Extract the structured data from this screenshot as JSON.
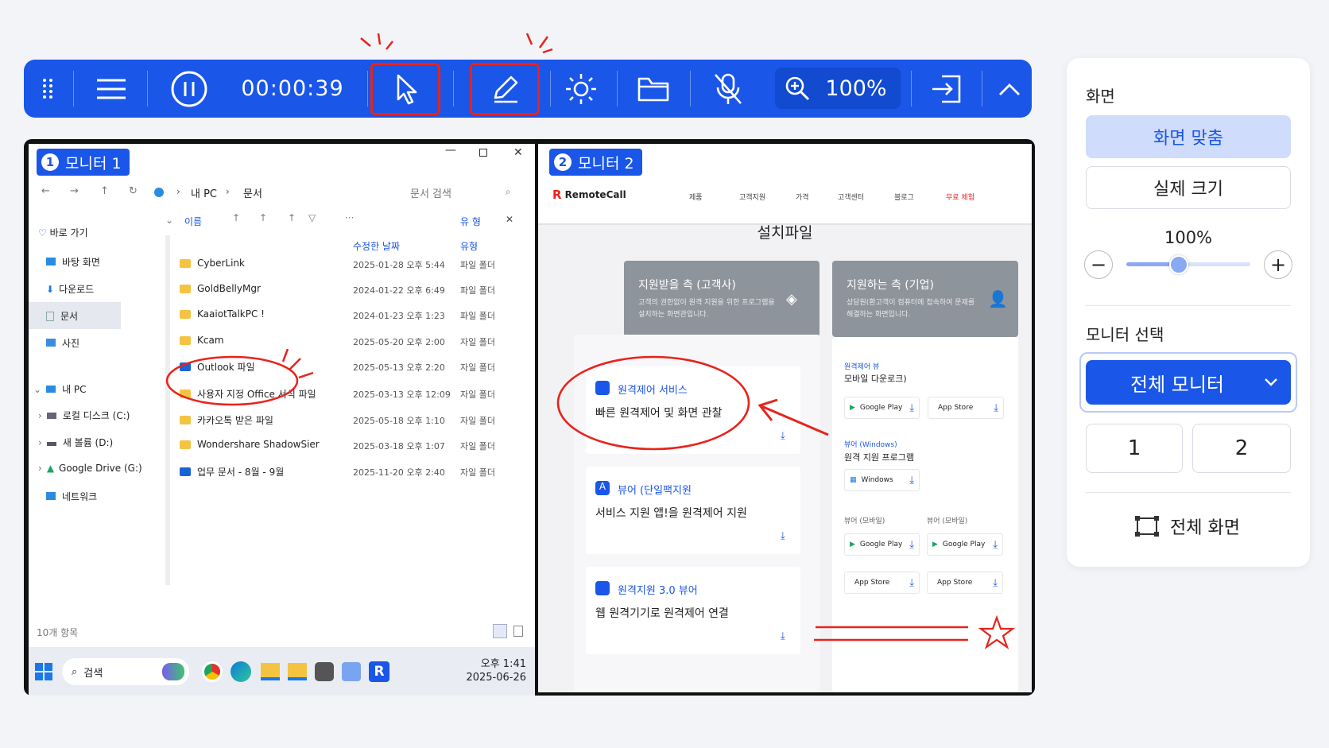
{
  "toolbar": {
    "timer": "00:00:39",
    "zoom": "100%",
    "icons": [
      "drag-handle-icon",
      "menu-icon",
      "pause-icon",
      "cursor-icon",
      "pen-icon",
      "brightness-icon",
      "folder-icon",
      "mic-off-icon",
      "zoom-icon",
      "exit-icon",
      "chevron-up-icon"
    ]
  },
  "monitor1": {
    "badge_num": "1",
    "badge_label": "모니터 1",
    "explorer": {
      "breadcrumb": [
        "내 PC",
        "문서"
      ],
      "search_placeholder": "문서 검색",
      "col_name": "이름",
      "col_modified": "수정한 날짜",
      "col_type": "유형",
      "col_type2": "유 형",
      "sidebar": [
        "바로 가기",
        "바탕 화면",
        "다운로드",
        "문서",
        "사진",
        "내 PC",
        "로컬 디스크 (C:)",
        "새 볼륨 (D:)",
        "Google Drive (G:)",
        "네트워크"
      ],
      "files": [
        {
          "name": "CyberLink",
          "date": "2025-01-28 오후 5:44",
          "type": "파일 폴더"
        },
        {
          "name": "GoldBellyMgr",
          "date": "2024-01-22 오후 6:49",
          "type": "파일 폴더"
        },
        {
          "name": "KaaiotTalkPC !",
          "date": "2024-01-23 오후 1:23",
          "type": "파일 폴더"
        },
        {
          "name": "Kcam",
          "date": "2025-05-20 오후 2:00",
          "type": "자일 폴더"
        },
        {
          "name": "Outlook 파일",
          "date": "2025-05-13 오후 2:20",
          "type": "자일 폴더"
        },
        {
          "name": "사용자 지정 Office 서식 파일",
          "date": "2025-03-13 오후 12:09",
          "type": "자일 폴더"
        },
        {
          "name": "카카오톡 받은 파일",
          "date": "2025-05-18 오후 1:10",
          "type": "자일 폴더"
        },
        {
          "name": "Wondershare ShadowSier",
          "date": "2025-03-18 오후 1:07",
          "type": "자일 폴더"
        },
        {
          "name": "업무 문서 - 8월 - 9월",
          "date": "2025-11-20 오후 2:40",
          "type": "자일 폴더"
        }
      ],
      "status": "10개 항목"
    },
    "taskbar": {
      "search": "검색",
      "time": "오후 1:41",
      "date": "2025-06-26"
    }
  },
  "monitor2": {
    "badge_num": "2",
    "badge_label": "모니터 2",
    "site": {
      "brand": "RemoteCall",
      "nav": [
        "제품",
        "고객지원",
        "가격",
        "고객센터",
        "블로그",
        "무료 체험"
      ],
      "heading": "설치파일",
      "left_header": {
        "title": "지원받을 측 (고객사)",
        "desc": "고객의 권한없이 원격 지원을 위한 프로그램을 설치하는 화면관입니다."
      },
      "right_header": {
        "title": "지원하는 측 (기업)",
        "desc": "상담원(환고객이 컴퓨터에 접속하여 문제를 해결하는 화면입니다."
      },
      "items": [
        {
          "title": "원격제어 서비스",
          "desc": "빠른 원격제어 및 화면 관찰"
        },
        {
          "title": "뷰어 (단일팩지원",
          "desc": "서비스 지원 앱!을 원격제어 지원"
        },
        {
          "title": "원격지원 3.0 뷰어",
          "desc": "웹 원격기기로 원격제어 연결"
        }
      ],
      "right": {
        "sec1_label": "원격제어 뷰",
        "sec1_title": "모바일 다운로크)",
        "sec2_label": "뷰어 (Windows)",
        "sec2_title": "원격 지원 프로그램",
        "sub_a": "뷰어 (모바일)",
        "sub_b": "뷰어 (모바일)",
        "google": "Google Play",
        "apple": "App Store",
        "windows": "Windows"
      }
    }
  },
  "panel": {
    "screen_title": "화면",
    "fit": "화면 맞춤",
    "actual": "실제 크기",
    "zoom": "100%",
    "zoom_level": 0.42,
    "monitor_title": "모니터 선택",
    "monitor_select": "전체 모니터",
    "m1": "1",
    "m2": "2",
    "fullscreen": "전체 화면"
  },
  "colors": {
    "accent": "#1a56e8",
    "annotation": "#e8231c"
  }
}
